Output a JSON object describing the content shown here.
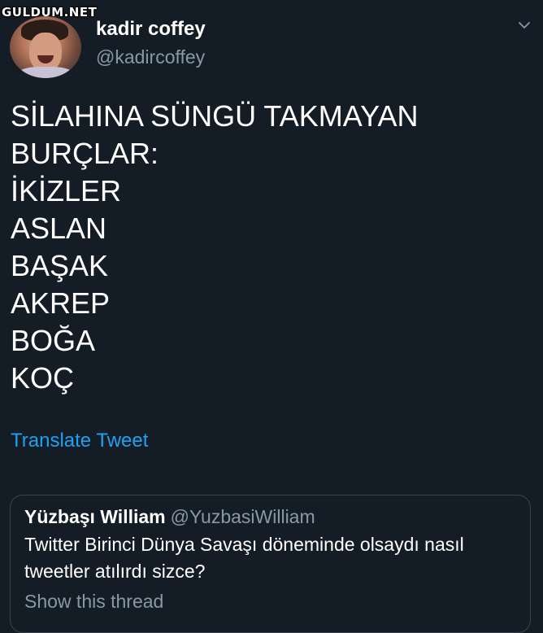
{
  "watermark": "GULDUM.NET",
  "author": {
    "display_name": "kadir coffey",
    "handle": "@kadircoffey"
  },
  "tweet": {
    "lines": [
      "SİLAHINA SÜNGÜ TAKMAYAN",
      "BURÇLAR:",
      "İKİZLER",
      "ASLAN",
      "BAŞAK",
      "AKREP",
      "BOĞA",
      "KOÇ"
    ],
    "translate_label": "Translate Tweet"
  },
  "quoted_tweet": {
    "display_name": "Yüzbaşı William",
    "handle": "@YuzbasiWilliam",
    "text": "Twitter Birinci Dünya Savaşı döneminde olsaydı nasıl tweetler atılırdı sizce?",
    "show_thread_label": "Show this thread"
  },
  "colors": {
    "background": "#141d26",
    "link": "#1da1f2",
    "muted": "#8899a6",
    "border": "#38444d"
  },
  "icons": {
    "more_options": "chevron-down-icon"
  }
}
